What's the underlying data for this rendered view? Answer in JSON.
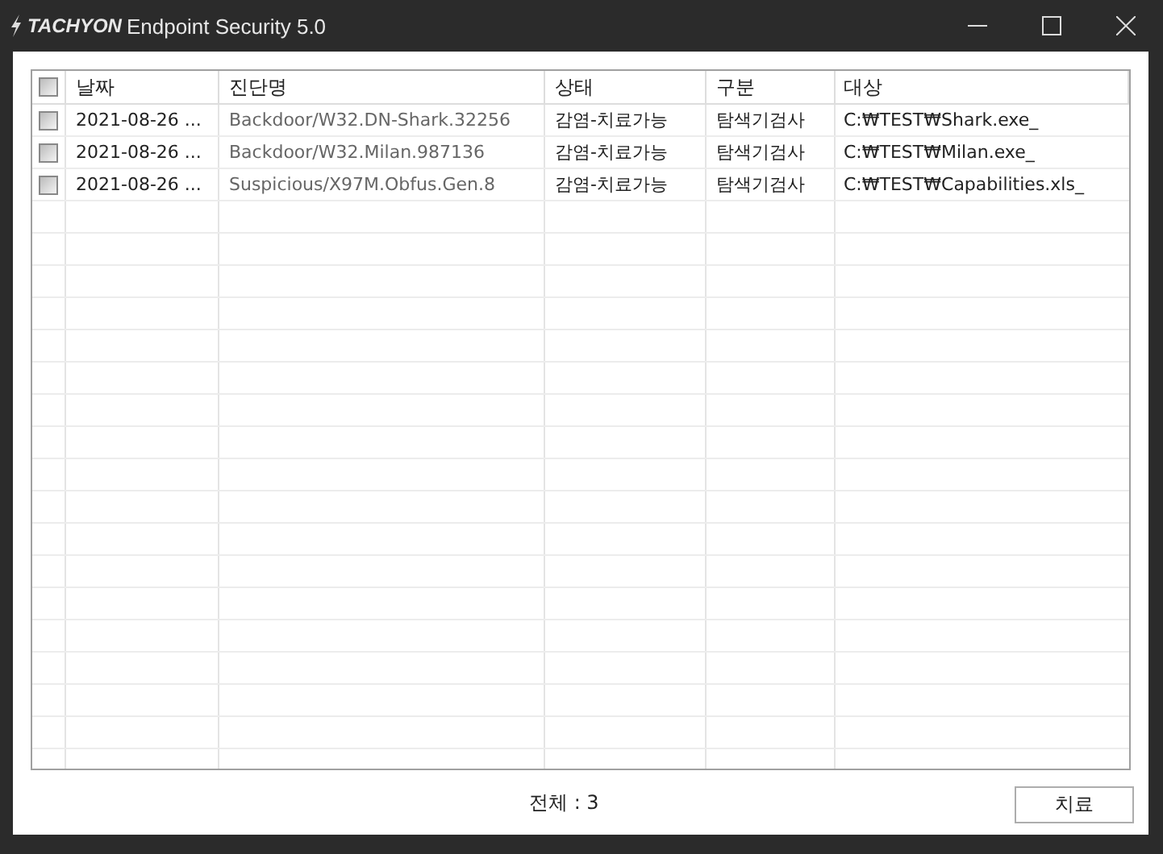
{
  "window": {
    "title_brand": "TACHYON",
    "title": "Endpoint Security 5.0"
  },
  "table": {
    "header_checkbox": {
      "checked": false
    },
    "columns": [
      "날짜",
      "진단명",
      "상태",
      "구분",
      "대상"
    ],
    "rows": [
      {
        "checked": false,
        "cells": [
          "2021-08-26 ...",
          "Backdoor/W32.DN-Shark.32256",
          "감염-치료가능",
          "탐색기검사",
          "C:₩TEST₩Shark.exe_"
        ]
      },
      {
        "checked": false,
        "cells": [
          "2021-08-26 ...",
          "Backdoor/W32.Milan.987136",
          "감염-치료가능",
          "탐색기검사",
          "C:₩TEST₩Milan.exe_"
        ]
      },
      {
        "checked": false,
        "cells": [
          "2021-08-26 ...",
          "Suspicious/X97M.Obfus.Gen.8",
          "감염-치료가능",
          "탐색기검사",
          "C:₩TEST₩Capabilities.xls_"
        ]
      }
    ]
  },
  "footer": {
    "total": "전체 : 3",
    "button": "치료"
  }
}
